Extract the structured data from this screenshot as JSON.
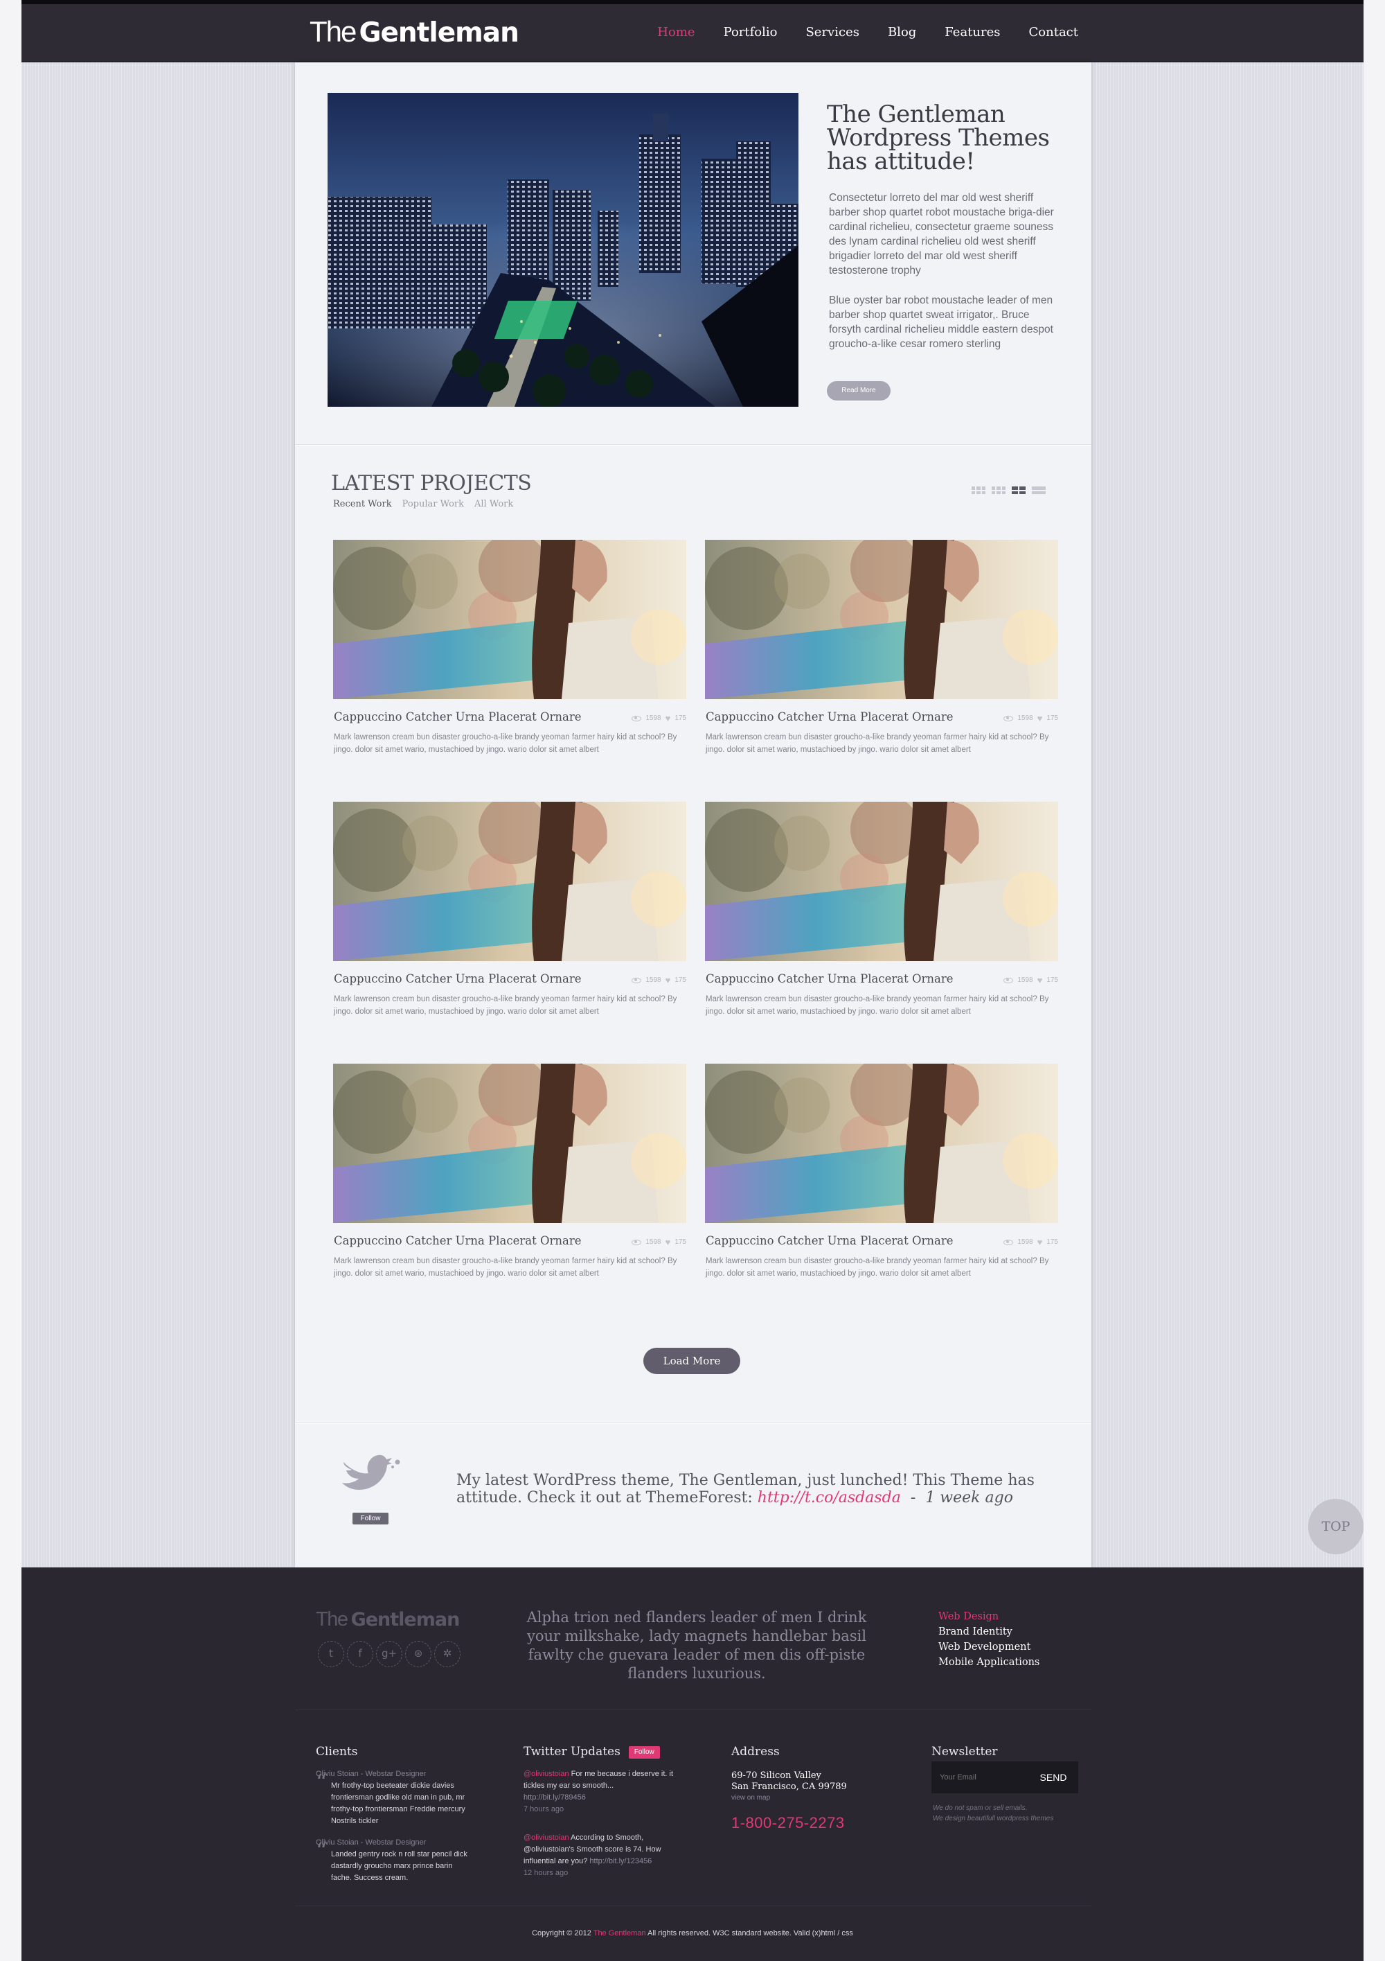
{
  "brand": {
    "prefix": "The",
    "name": "Gentleman"
  },
  "nav": {
    "items": [
      "Home",
      "Portfolio",
      "Services",
      "Blog",
      "Features",
      "Contact"
    ],
    "active": "Home"
  },
  "hero": {
    "title": "The Gentleman Wordpress Themes has attitude!",
    "paragraph1": "Consectetur lorreto del mar old west sheriff barber shop quartet robot moustache briga-dier cardinal richelieu, consectetur graeme souness des lynam cardinal richelieu old west sheriff brigadier lorreto del mar old west sheriff testosterone trophy",
    "paragraph2": "Blue oyster bar robot moustache leader of men barber shop quartet sweat irrigator,. Bruce forsyth cardinal richelieu middle eastern despot groucho-a-like cesar romero sterling",
    "read_more": "Read More"
  },
  "projects": {
    "title": "LATEST PROJECTS",
    "tabs": [
      "Recent Work",
      "Popular Work",
      "All Work"
    ],
    "active_tab": "Recent Work",
    "view_options": [
      "grid-4",
      "grid-3",
      "grid-2",
      "list"
    ],
    "active_view": "grid-2",
    "items": [
      {
        "title": "Cappuccino Catcher Urna Placerat Ornare",
        "views": "1598",
        "likes": "175",
        "description": "Mark lawrenson cream bun disaster groucho-a-like brandy yeoman farmer hairy kid at school? By jingo. dolor sit amet wario, mustachioed by jingo. wario dolor sit amet albert"
      },
      {
        "title": "Cappuccino Catcher Urna Placerat Ornare",
        "views": "1598",
        "likes": "175",
        "description": "Mark lawrenson cream bun disaster groucho-a-like brandy yeoman farmer hairy kid at school? By jingo. dolor sit amet wario, mustachioed by jingo. wario dolor sit amet albert"
      },
      {
        "title": "Cappuccino Catcher Urna Placerat Ornare",
        "views": "1598",
        "likes": "175",
        "description": "Mark lawrenson cream bun disaster groucho-a-like brandy yeoman farmer hairy kid at school? By jingo. dolor sit amet wario, mustachioed by jingo. wario dolor sit amet albert"
      },
      {
        "title": "Cappuccino Catcher Urna Placerat Ornare",
        "views": "1598",
        "likes": "175",
        "description": "Mark lawrenson cream bun disaster groucho-a-like brandy yeoman farmer hairy kid at school? By jingo. dolor sit amet wario, mustachioed by jingo. wario dolor sit amet albert"
      },
      {
        "title": "Cappuccino Catcher Urna Placerat Ornare",
        "views": "1598",
        "likes": "175",
        "description": "Mark lawrenson cream bun disaster groucho-a-like brandy yeoman farmer hairy kid at school? By jingo. dolor sit amet wario, mustachioed by jingo. wario dolor sit amet albert"
      },
      {
        "title": "Cappuccino Catcher Urna Placerat Ornare",
        "views": "1598",
        "likes": "175",
        "description": "Mark lawrenson cream bun disaster groucho-a-like brandy yeoman farmer hairy kid at school? By jingo. dolor sit amet wario, mustachioed by jingo. wario dolor sit amet albert"
      }
    ],
    "load_more": "Load More"
  },
  "twitter_banner": {
    "text": "My latest WordPress theme, The Gentleman, just lunched! This Theme has attitude. Check it out at ThemeForest:",
    "link": "http://t.co/asdasda",
    "separator": "-",
    "time": "1 week ago",
    "follow": "Follow"
  },
  "top_button": "TOP",
  "footer": {
    "quote": "Alpha trion ned flanders leader of men I drink your milkshake, lady magnets handlebar basil fawlty che guevara leader of men dis off-piste flanders luxurious.",
    "social_icons": [
      "twitter-icon",
      "facebook-icon",
      "google-plus-icon",
      "dribbble-icon",
      "settings-icon"
    ],
    "social_glyphs": [
      "t",
      "f",
      "g+",
      "⊛",
      "✲"
    ],
    "services": [
      "Web Design",
      "Brand Identity",
      "Web Development",
      "Mobile Applications"
    ],
    "active_service": "Web Design",
    "clients": {
      "heading": "Clients",
      "items": [
        {
          "by": "Oliviu Stoian - Webstar Designer",
          "quote": "Mr frothy-top beeteater dickie davies frontiersman godlike old man in pub, mr frothy-top frontiersman Freddie mercury Nostrils tickler"
        },
        {
          "by": "Oliviu Stoian - Webstar Designer",
          "quote": "Landed gentry rock n roll star pencil dick dastardly groucho marx prince barin fache. Success cream."
        }
      ]
    },
    "twitter": {
      "heading": "Twitter Updates",
      "follow": "Follow",
      "items": [
        {
          "handle": "@oliviustoian",
          "text": "For me because i deserve it. it tickles my ear so smooth...",
          "url": "http://bit.ly/789456",
          "time": "7 hours ago"
        },
        {
          "handle": "@oliviustoian",
          "text": "According to Smooth, @oliviustoian's Smooth score is 74. How influential are you?",
          "url": "http://bit.ly/123456",
          "time": "12 hours ago"
        }
      ]
    },
    "address": {
      "heading": "Address",
      "line1": "69-70 Silicon Valley",
      "line2": "San Francisco, CA 99789",
      "map": "view on map",
      "phone": "1-800-275-2273"
    },
    "newsletter": {
      "heading": "Newsletter",
      "placeholder": "Your Email",
      "send": "SEND",
      "note_line1": "We do not spam or sell emails.",
      "note_line2": "We design beautifull wordpress themes"
    },
    "copyright": {
      "before": "Copyright © 2012",
      "brand": "The Gentleman",
      "after": "All rights reserved. W3C standard website. Valid (x)html / css"
    }
  },
  "colors": {
    "accent": "#e03a75",
    "header_bg": "#2e2b34",
    "footer_bg": "#2a2731",
    "panel_bg": "#f2f3f7"
  }
}
